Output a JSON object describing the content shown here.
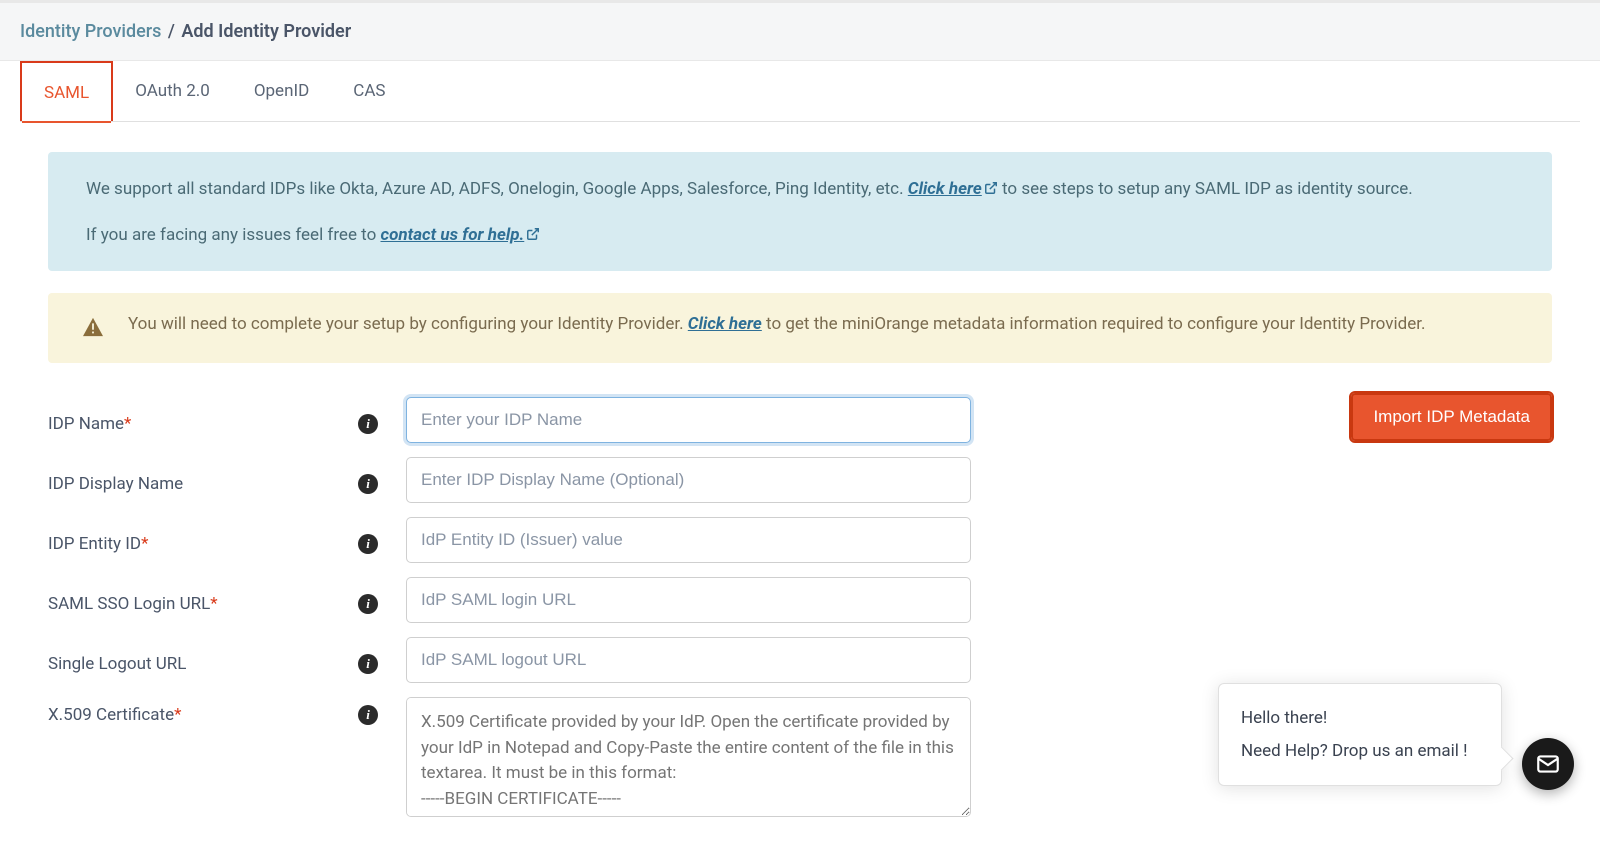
{
  "breadcrumb": {
    "parent": "Identity Providers",
    "separator": "/",
    "current": "Add Identity Provider"
  },
  "tabs": {
    "saml": "SAML",
    "oauth": "OAuth 2.0",
    "openid": "OpenID",
    "cas": "CAS"
  },
  "info_alert": {
    "line1_a": "We support all standard IDPs like Okta, Azure AD, ADFS, Onelogin, Google Apps, Salesforce, Ping Identity, etc. ",
    "click_here": "Click here",
    "line1_b": " to see steps to setup any SAML IDP as identity source.",
    "line2_a": "If you are facing any issues feel free to ",
    "contact_link": "contact us for help."
  },
  "warn_alert": {
    "line_a": "You will need to complete your setup by configuring your Identity Provider. ",
    "click_here": "Click here",
    "line_b": " to get the miniOrange metadata information required to configure your Identity Provider."
  },
  "buttons": {
    "import": "Import IDP Metadata"
  },
  "fields": {
    "idp_name": {
      "label": "IDP Name",
      "placeholder": "Enter your IDP Name",
      "required": true
    },
    "idp_display": {
      "label": "IDP Display Name",
      "placeholder": "Enter IDP Display Name (Optional)",
      "required": false
    },
    "entity_id": {
      "label": "IDP Entity ID",
      "placeholder": "IdP Entity ID (Issuer) value",
      "required": true
    },
    "sso_url": {
      "label": "SAML SSO Login URL",
      "placeholder": "IdP SAML login URL",
      "required": true
    },
    "slo_url": {
      "label": "Single Logout URL",
      "placeholder": "IdP SAML logout URL",
      "required": false
    },
    "cert": {
      "label": "X.509 Certificate",
      "placeholder": "X.509 Certificate provided by your IdP. Open the certificate provided by your IdP in Notepad and Copy-Paste the entire content of the file in this textarea. It must be in this format:\n-----BEGIN CERTIFICATE-----\nMIIDLTCCAu .......................... rest_of_the_certificate ..........................",
      "required": true
    }
  },
  "help": {
    "line1": "Hello there!",
    "line2": "Need Help? Drop us an email !"
  },
  "required_mark": "*"
}
